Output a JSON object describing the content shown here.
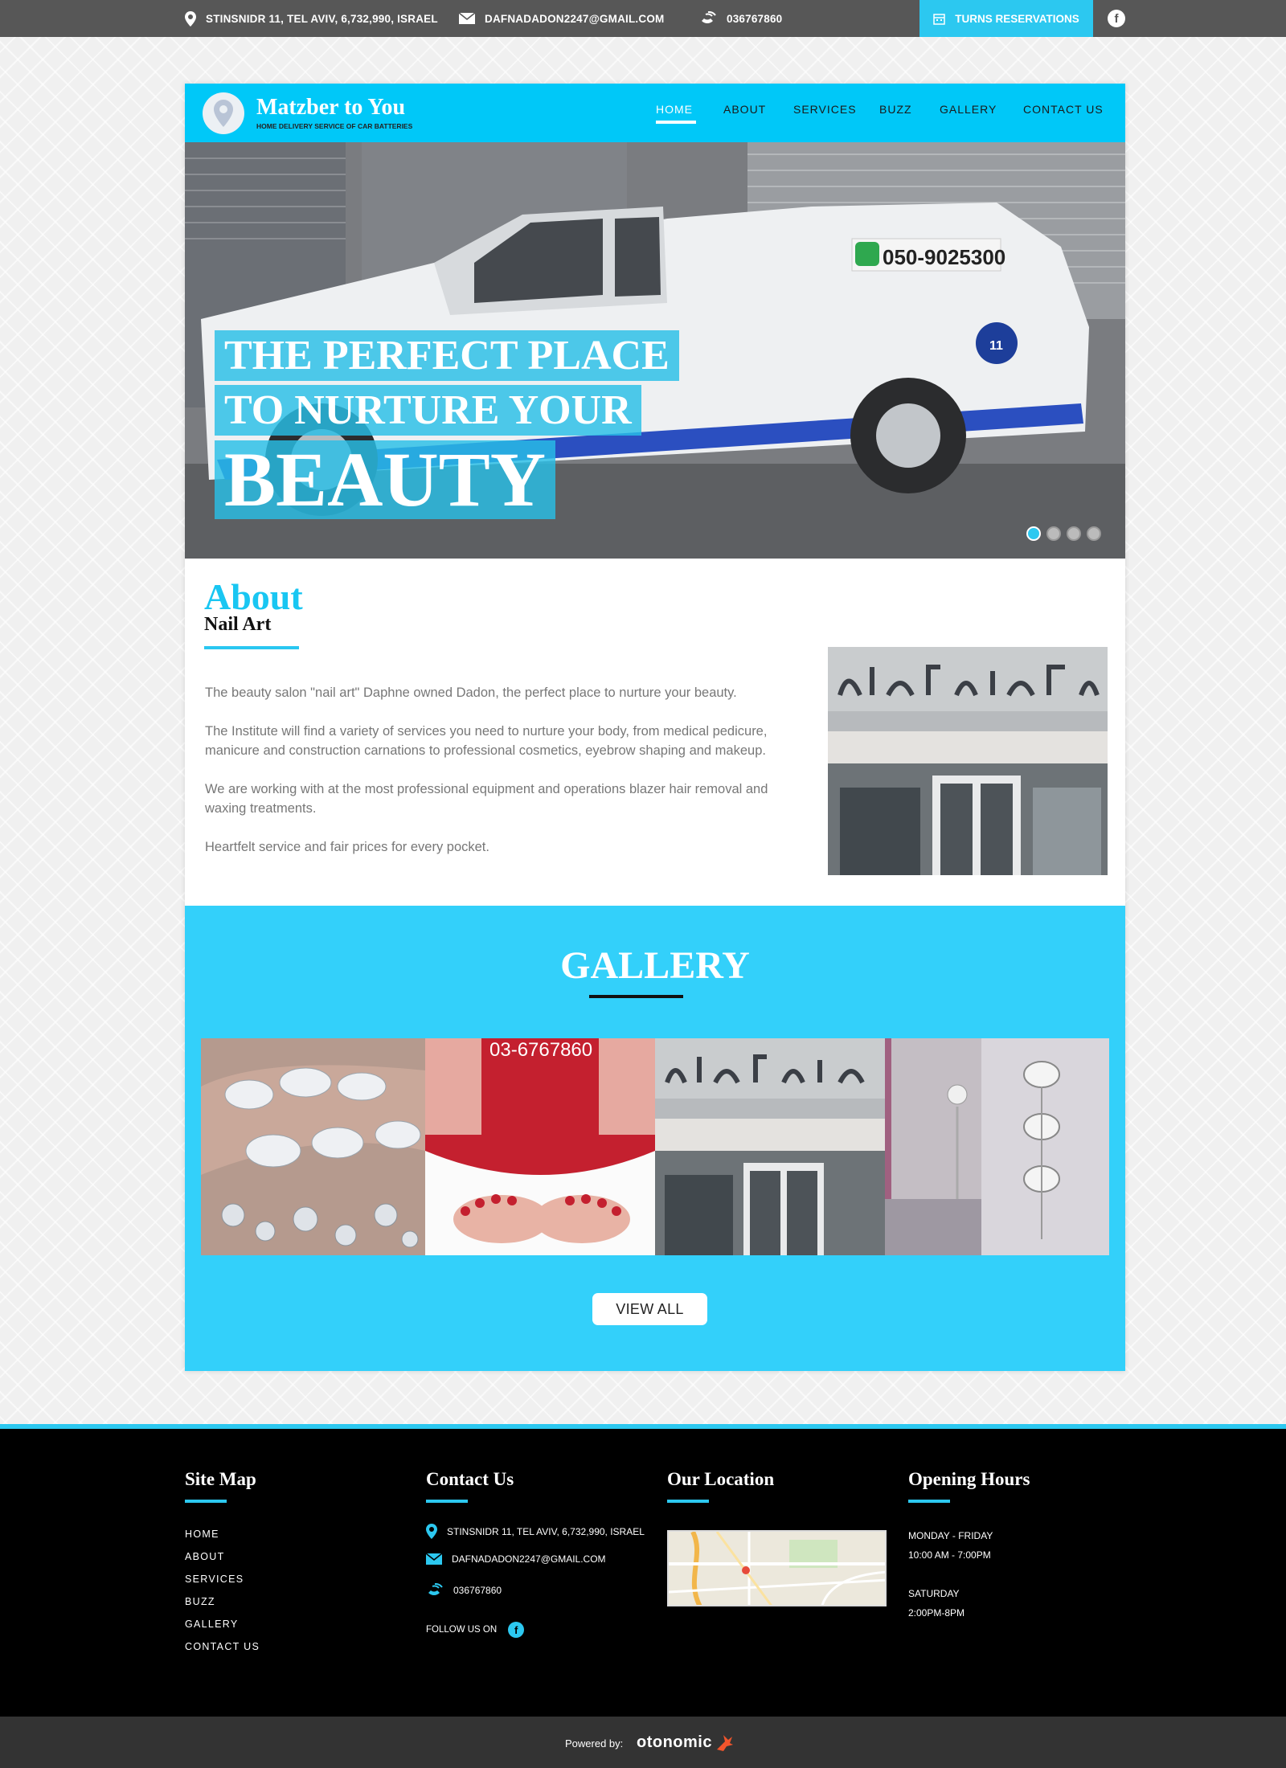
{
  "topbar": {
    "address": "STINSNIDR 11, TEL AVIV, 6,732,990, ISRAEL",
    "email": "DAFNADADON2247@GMAIL.COM",
    "phone": "036767860",
    "reserve_label": "TURNS RESERVATIONS",
    "facebook_glyph": "f"
  },
  "header": {
    "title": "Matzber to You",
    "subtitle": "HOME DELIVERY SERVICE OF CAR BATTERIES",
    "nav": [
      "HOME",
      "ABOUT",
      "SERVICES",
      "BUZZ",
      "GALLERY",
      "CONTACT US"
    ],
    "active_nav": "HOME"
  },
  "hero": {
    "line1": "THE PERFECT PLACE",
    "line2": "TO NURTURE YOUR",
    "line3": "BEAUTY",
    "truck_phone": "050-9025300",
    "truck_number": "11",
    "slides": 4,
    "active_slide": 1
  },
  "about": {
    "title": "About",
    "subtitle": "Nail Art",
    "paragraphs": [
      "The beauty salon \"nail art\" Daphne owned Dadon, the perfect place to nurture your beauty.",
      "The Institute will find a variety of services you need to nurture your body, from medical pedicure, manicure and construction carnations to professional cosmetics, eyebrow shaping and makeup.",
      "We are working with at the most professional equipment and operations blazer hair removal and waxing treatments.",
      "Heartfelt service and fair prices for every pocket."
    ]
  },
  "gallery": {
    "title": "GALLERY",
    "tile2_phone": "03-6767860",
    "view_all": "VIEW ALL"
  },
  "footer": {
    "sitemap_title": "Site Map",
    "sitemap_links": [
      "HOME",
      "ABOUT",
      "SERVICES",
      "BUZZ",
      "GALLERY",
      "CONTACT US"
    ],
    "contact_title": "Contact Us",
    "contact_address": "STINSNIDR 11, TEL AVIV, 6,732,990, ISRAEL",
    "contact_email": "DAFNADADON2247@GMAIL.COM",
    "contact_phone": "036767860",
    "follow_label": "FOLLOW US ON",
    "follow_glyph": "f",
    "location_title": "Our Location",
    "hours_title": "Opening Hours",
    "hours_weekday_label": "MONDAY - FRIDAY",
    "hours_weekday": "10:00 AM - 7:00PM",
    "hours_saturday_label": "SATURDAY",
    "hours_saturday": "2:00PM-8PM"
  },
  "bottom": {
    "powered_label": "Powered by:",
    "brand": "otonomic"
  },
  "colors": {
    "accent": "#2cc8f0",
    "header_blue": "#00c8f8",
    "topbar_gray": "#575757",
    "footer_black": "#000000"
  }
}
